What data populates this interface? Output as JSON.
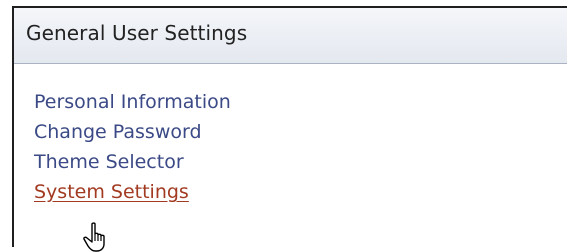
{
  "panel": {
    "title": "General User Settings"
  },
  "links": [
    {
      "label": "Personal Information",
      "active": false
    },
    {
      "label": "Change Password",
      "active": false
    },
    {
      "label": "Theme Selector",
      "active": false
    },
    {
      "label": "System Settings",
      "active": true
    }
  ],
  "cursor": {
    "icon": "hand-pointer-icon"
  },
  "colors": {
    "link": "#3b4a86",
    "link_hover": "#a23a22",
    "header_bg": "#e4e8ef"
  }
}
